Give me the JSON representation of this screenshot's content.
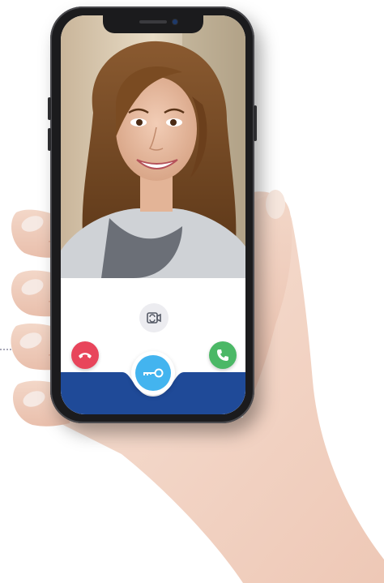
{
  "app": {
    "title": ""
  },
  "call": {
    "caller_video": "smiling-woman-video-feed",
    "switch_camera_icon": "camera-switch-icon",
    "hangup_icon": "phone-hangup-icon",
    "answer_icon": "phone-answer-icon",
    "unlock_icon": "key-icon"
  },
  "colors": {
    "hangup": "#e8455b",
    "answer": "#4bb866",
    "unlock": "#43b4ef",
    "bottom_bar": "#1f4a98",
    "switch_bg": "#ececf0"
  }
}
